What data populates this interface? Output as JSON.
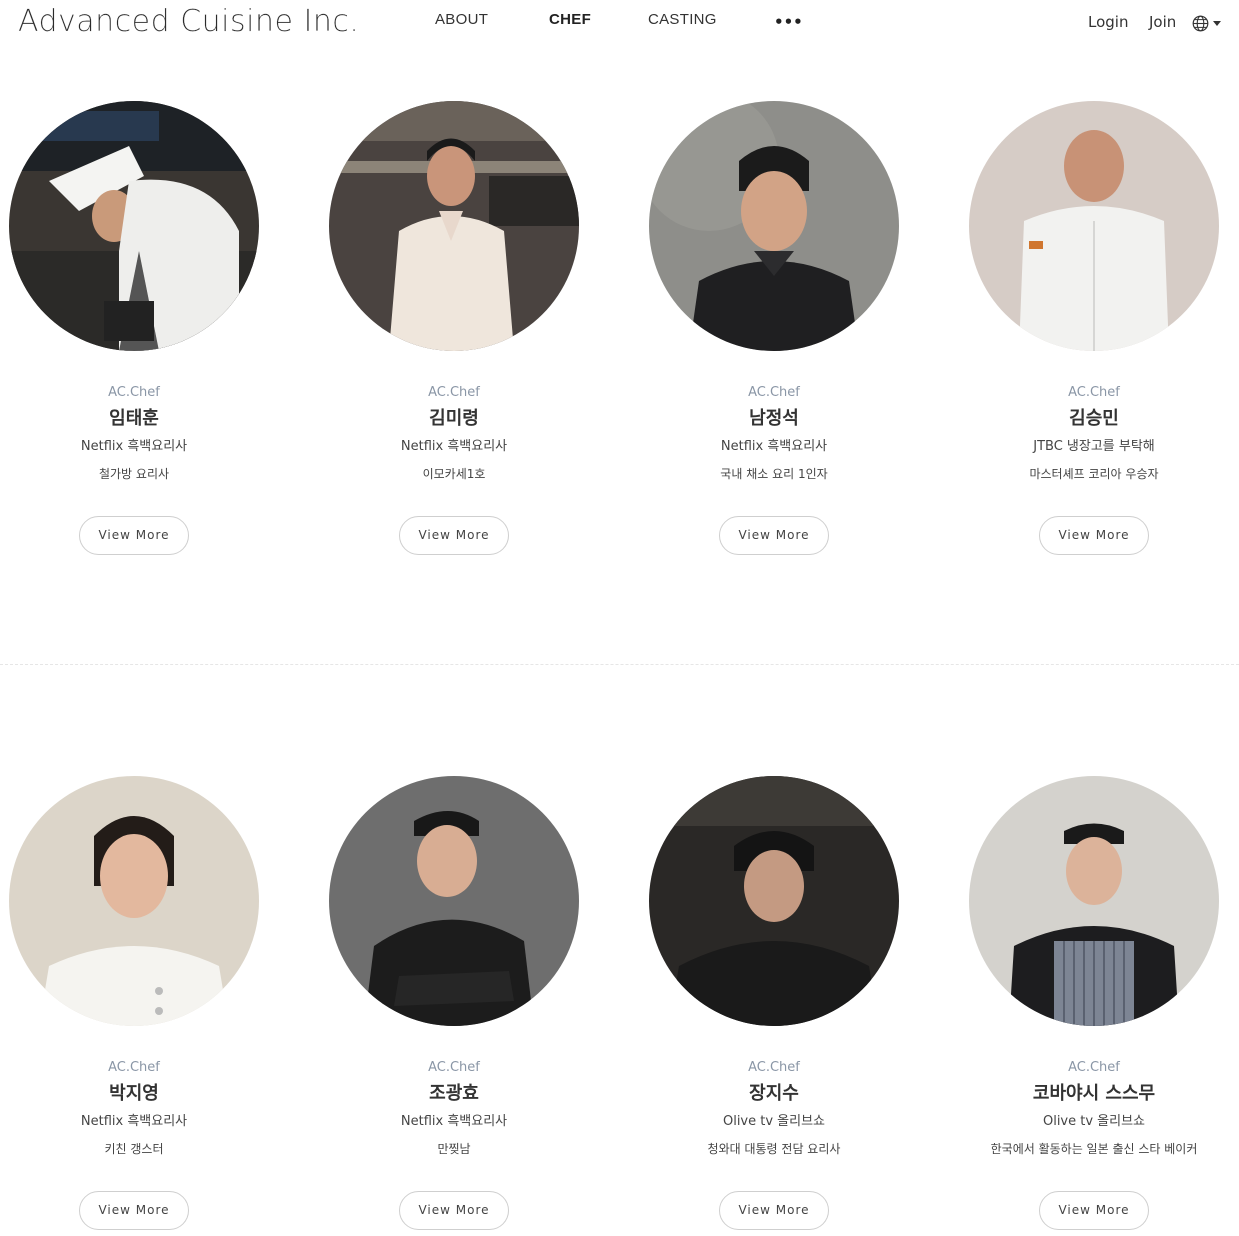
{
  "header": {
    "logo": "Advanced Cuisine Inc.",
    "nav": [
      {
        "label": "ABOUT",
        "active": false
      },
      {
        "label": "CHEF",
        "active": true
      },
      {
        "label": "CASTING",
        "active": false
      }
    ],
    "more_label": "•••",
    "login_label": "Login",
    "join_label": "Join",
    "language_icon": "globe-icon"
  },
  "chefs": [
    {
      "tag": "AC.Chef",
      "name": "임태훈",
      "line1": "Netflix 흑백요리사",
      "line2": "철가방 요리사",
      "button": "View More"
    },
    {
      "tag": "AC.Chef",
      "name": "김미령",
      "line1": "Netflix 흑백요리사",
      "line2": "이모카세1호",
      "button": "View More"
    },
    {
      "tag": "AC.Chef",
      "name": "남정석",
      "line1": "Netflix 흑백요리사",
      "line2": "국내 채소 요리 1인자",
      "button": "View More"
    },
    {
      "tag": "AC.Chef",
      "name": "김승민",
      "line1": "JTBC 냉장고를 부탁해",
      "line2": "마스터셰프 코리아 우승자",
      "button": "View More"
    },
    {
      "tag": "AC.Chef",
      "name": "박지영",
      "line1": "Netflix 흑백요리사",
      "line2": "키친 갱스터",
      "button": "View More"
    },
    {
      "tag": "AC.Chef",
      "name": "조광효",
      "line1": "Netflix 흑백요리사",
      "line2": "만찢남",
      "button": "View More"
    },
    {
      "tag": "AC.Chef",
      "name": "장지수",
      "line1": "Olive tv 올리브쇼",
      "line2": "청와대 대통령 전담 요리사",
      "button": "View More"
    },
    {
      "tag": "AC.Chef",
      "name": "코바야시 스스무",
      "line1": "Olive tv 올리브쇼",
      "line2": "한국에서 활동하는 일본 출신 스타 베이커",
      "button": "View More"
    }
  ]
}
